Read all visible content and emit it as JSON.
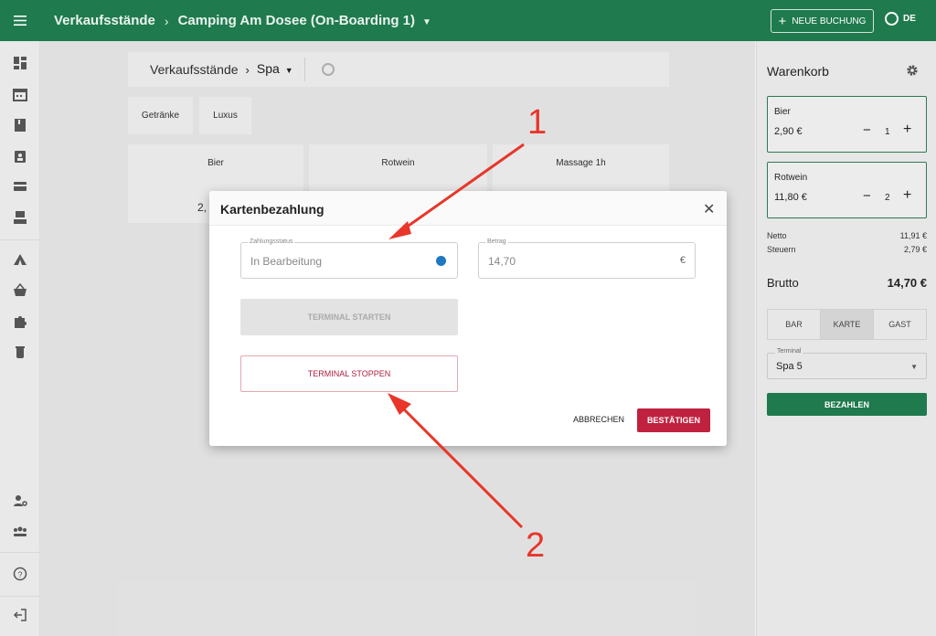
{
  "topbar": {
    "section": "Verkaufsstände",
    "location": "Camping Am Dosee (On-Boarding 1)",
    "new_booking": "NEUE BUCHUNG",
    "language": "DE"
  },
  "main": {
    "breadcrumb_section": "Verkaufsstände",
    "breadcrumb_stand": "Spa",
    "categories": [
      "Getränke",
      "Luxus"
    ],
    "products": [
      {
        "name": "Bier",
        "price": "2,"
      },
      {
        "name": "Rotwein",
        "price": ""
      },
      {
        "name": "Massage 1h",
        "price": ""
      }
    ]
  },
  "cart": {
    "title": "Warenkorb",
    "items": [
      {
        "name": "Bier",
        "price": "2,90 €",
        "qty": "1"
      },
      {
        "name": "Rotwein",
        "price": "11,80 €",
        "qty": "2"
      }
    ],
    "netto_label": "Netto",
    "netto": "11,91 €",
    "steuern_label": "Steuern",
    "steuern": "2,79 €",
    "brutto_label": "Brutto",
    "brutto": "14,70 €",
    "pay_tabs": [
      "BAR",
      "KARTE",
      "GAST"
    ],
    "terminal_label": "Terminal",
    "terminal_value": "Spa 5",
    "pay_button": "BEZAHLEN"
  },
  "modal": {
    "title": "Kartenbezahlung",
    "status_label": "Zahlungsstatus",
    "status_value": "In Bearbeitung",
    "amount_label": "Betrag",
    "amount_value": "14,70",
    "currency": "€",
    "start_button": "TERMINAL STARTEN",
    "stop_button": "TERMINAL STOPPEN",
    "cancel_button": "ABBRECHEN",
    "confirm_button": "BESTÄTIGEN"
  },
  "annotations": {
    "one": "1",
    "two": "2"
  },
  "colors": {
    "primary": "#1f7a4d",
    "danger": "#c0213f",
    "status_dot": "#1f78c1",
    "annotation": "#e8362a"
  }
}
